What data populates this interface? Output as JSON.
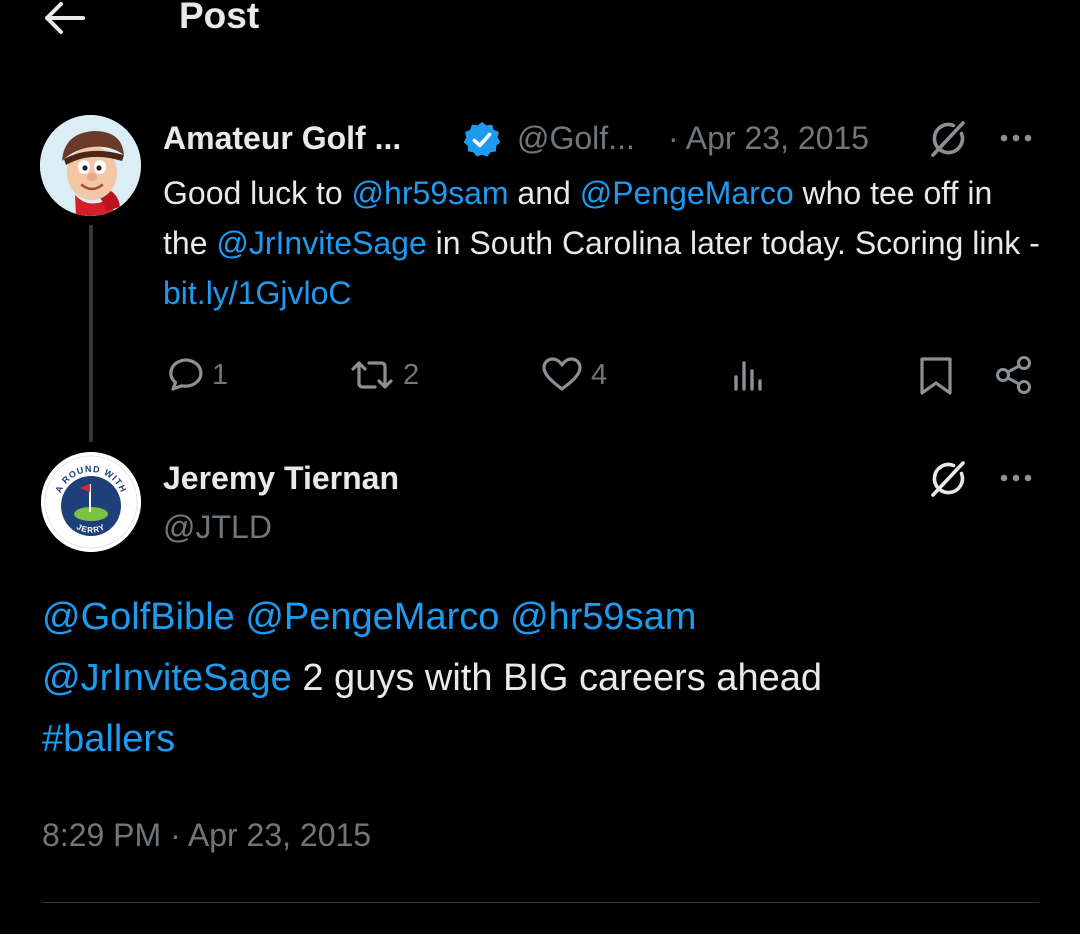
{
  "header": {
    "title": "Post",
    "back_icon": "arrow-left-icon"
  },
  "parent_post": {
    "display_name": "Amateur Golf ...",
    "handle": "@Golf...",
    "date": "· Apr 23, 2015",
    "verified": true,
    "avatar": "cartoon-golfer-avatar",
    "text": {
      "t1": "Good luck to ",
      "m1": "@hr59sam",
      "t2": " and ",
      "m2": "@PengeMarco",
      "t3": " who tee off in the ",
      "m3": "@JrInviteSage",
      "t4": " in South Carolina later today. Scoring link - ",
      "link": "bit.ly/1GjvloC"
    },
    "stats": {
      "replies": "1",
      "reposts": "2",
      "likes": "4"
    }
  },
  "reply_post": {
    "display_name": "Jeremy Tiernan",
    "handle": "@JTLD",
    "avatar": "a-round-with-jerry-logo",
    "avatar_text": "A ROUND WITH JERRY",
    "text": {
      "m1": "@GolfBible",
      "s1": " ",
      "m2": "@PengeMarco",
      "s2": " ",
      "m3": "@hr59sam",
      "m4": "@JrInviteSage",
      "t1": " 2 guys with BIG careers ahead",
      "hashtag": "#ballers"
    },
    "timestamp": "8:29 PM · Apr 23, 2015"
  },
  "colors": {
    "background": "#000000",
    "text_primary": "#e7e9ea",
    "text_secondary": "#71767b",
    "link": "#1d9bf0",
    "divider": "#2f3336",
    "thread_line": "#333639"
  }
}
